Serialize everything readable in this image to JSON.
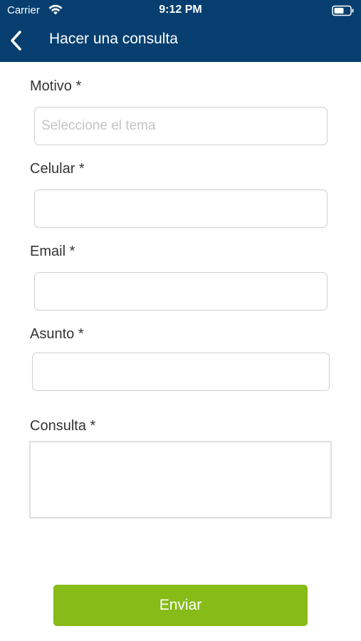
{
  "status_bar": {
    "carrier": "Carrier",
    "time": "9:12 PM",
    "wifi_icon": "wifi-icon",
    "battery_icon": "battery-icon"
  },
  "nav": {
    "back_icon": "chevron-left-icon",
    "title": "Hacer una consulta"
  },
  "form": {
    "motivo": {
      "label": "Motivo *",
      "placeholder": "Seleccione el tema",
      "value": ""
    },
    "celular": {
      "label": "Celular *",
      "value": ""
    },
    "email": {
      "label": "Email *",
      "value": ""
    },
    "asunto": {
      "label": "Asunto *",
      "value": ""
    },
    "consulta": {
      "label": "Consulta *",
      "value": ""
    },
    "submit_label": "Enviar"
  },
  "colors": {
    "header": "#063f6f",
    "accent_button": "#86bb18",
    "label_text": "#333333",
    "field_border": "#cfcfcf"
  }
}
